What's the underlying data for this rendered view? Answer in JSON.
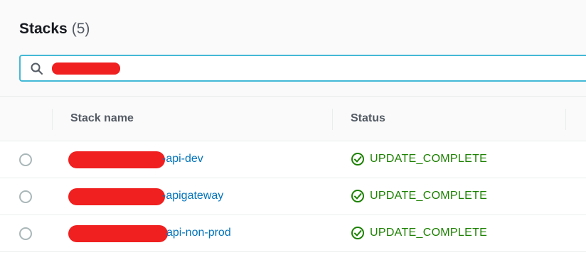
{
  "header": {
    "title": "Stacks",
    "count": "(5)"
  },
  "search": {
    "value": "",
    "placeholder": ""
  },
  "table": {
    "columns": [
      "Stack name",
      "Status"
    ],
    "rows": [
      {
        "name_suffix": "-api-dev",
        "status": "UPDATE_COMPLETE"
      },
      {
        "name_suffix": "-apigateway",
        "status": "UPDATE_COMPLETE"
      },
      {
        "name_suffix": "api-non-prod",
        "status": "UPDATE_COMPLETE"
      }
    ]
  },
  "icons": {
    "search": "search-icon",
    "status": "check-circle-icon"
  },
  "colors": {
    "link": "#0073bb",
    "success": "#1d8102",
    "focus": "#44b9d6",
    "redaction": "#f02020"
  }
}
